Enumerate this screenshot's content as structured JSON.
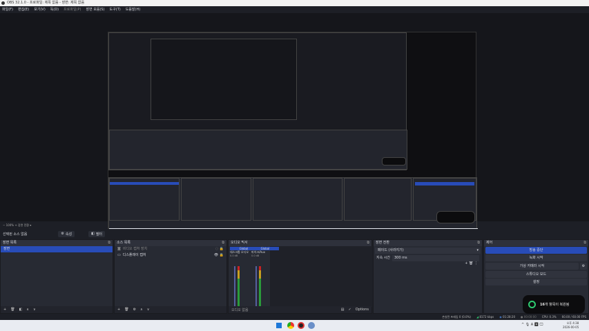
{
  "window": {
    "title": "OBS 32.1.0 - 프로파일: 제목 없음 - 장면: 제목 없음"
  },
  "menu": [
    "파일(F)",
    "편집(E)",
    "보기(V)",
    "독(D)",
    "프로파일(P)",
    "장면 모음(S)",
    "도구(T)",
    "도움말(H)"
  ],
  "zoom_row": "− 100% +  장면 전환  ▾",
  "source_toolbar": {
    "status": "선택된 소스 없음",
    "properties": "속성",
    "filters": "필터"
  },
  "scenes": {
    "title": "장면 목록",
    "items": [
      "장면"
    ]
  },
  "sources": {
    "title": "소스 목록",
    "items": [
      {
        "label": "비디오 캡처 장치",
        "icon": "camera-icon"
      },
      {
        "label": "디스플레이 캡처",
        "icon": "monitor-icon"
      }
    ]
  },
  "mixer": {
    "title": "오디오 믹서",
    "channels": [
      {
        "tag": "Global",
        "name": "데스크톱 오디오",
        "db": "0.0 dB"
      },
      {
        "tag": "Global",
        "name": "마이크/Aux",
        "db": "0.0 dB"
      }
    ],
    "footer": "오디오 없음",
    "options": "Options"
  },
  "transitions": {
    "title": "장면 전환",
    "selected": "페이드 (사라지기)",
    "duration_label": "지속 시간",
    "duration": "300 ms"
  },
  "controls": {
    "title": "제어",
    "buttons": [
      "방송 중단",
      "녹화 시작",
      "가상 카메라 시작",
      "스튜디오 모드",
      "설정"
    ]
  },
  "status": {
    "dropped": "손실된 프레임 0 (0.0%)",
    "bitrate": "8172 kbps",
    "stream_time": "01:28:20",
    "rec_time": "00:00:00",
    "cpu": "CPU: 0.3%",
    "fps": "60.00 / 60.00 FPS"
  },
  "toast": {
    "count": "16",
    "text": "개 항목이 복원됨"
  },
  "taskbar": {
    "time": "오후 4:38",
    "date": "2026-00-05"
  },
  "colors": {
    "accent": "#284cb8",
    "bg": "#1d1f26",
    "dock": "#272a33"
  }
}
